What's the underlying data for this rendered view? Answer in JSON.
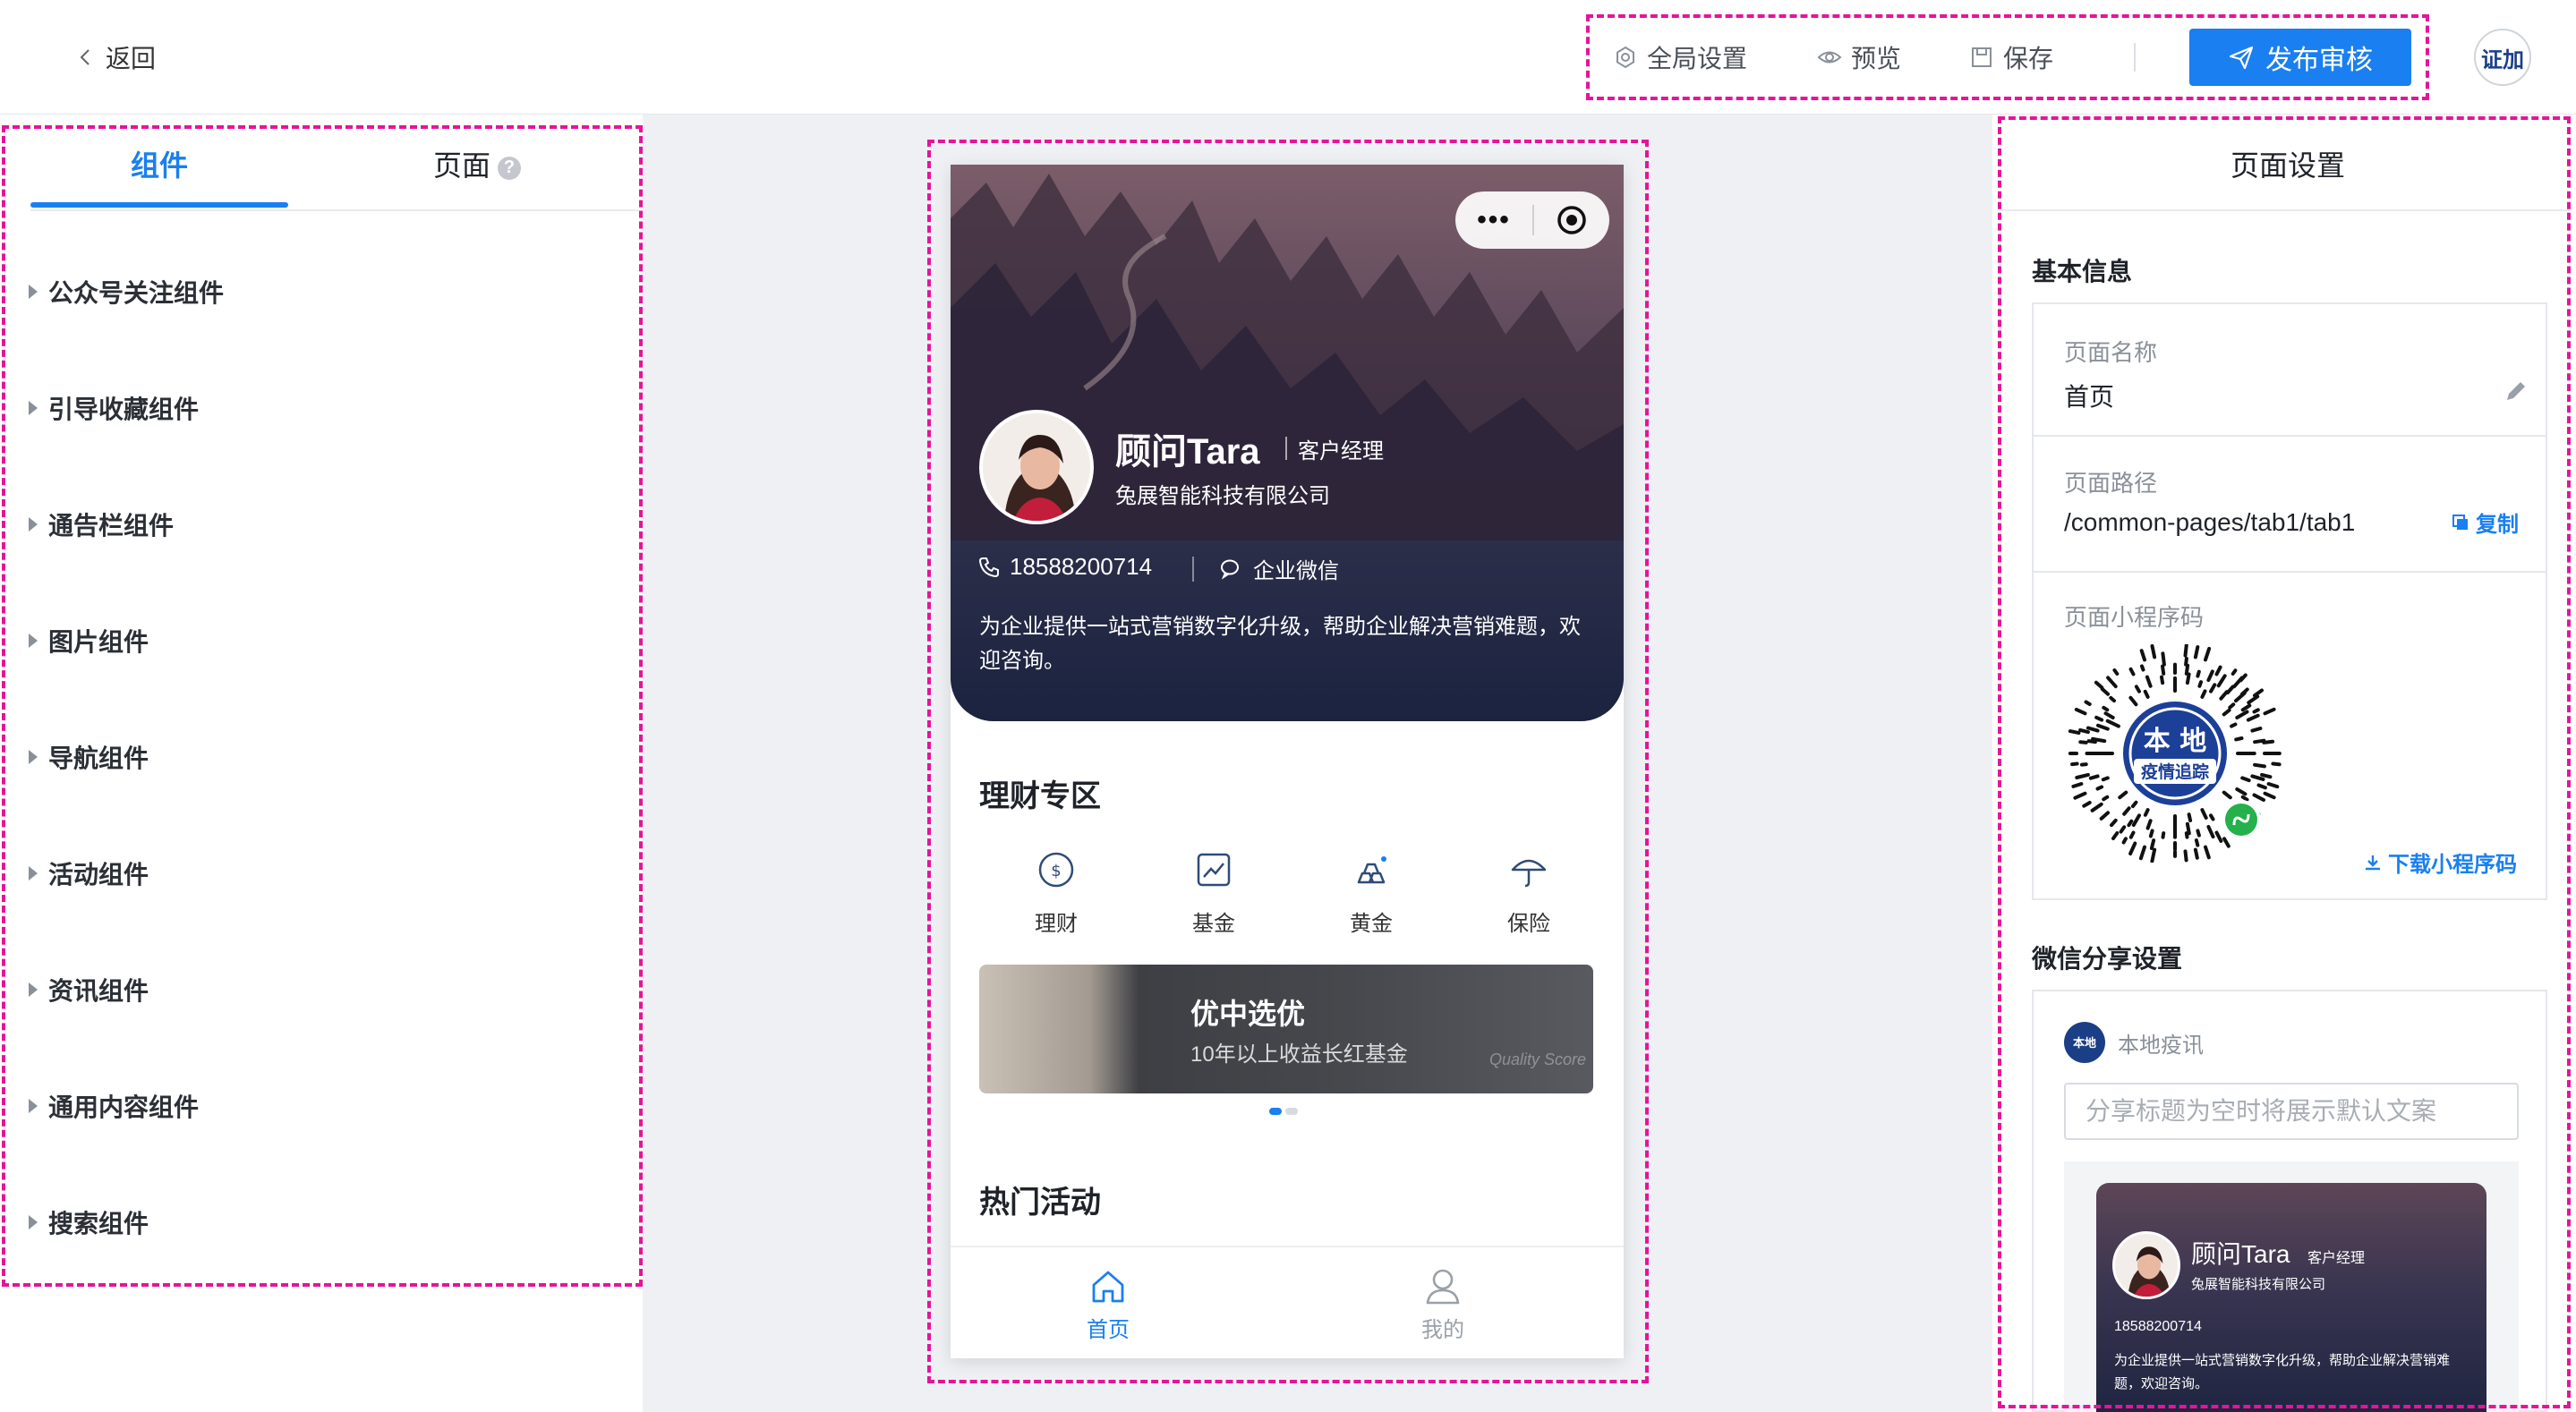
{
  "topbar": {
    "back_label": "返回",
    "global_settings_label": "全局设置",
    "preview_label": "预览",
    "save_label": "保存",
    "publish_label": "发布审核",
    "avatar_text": "证加"
  },
  "left_panel": {
    "tabs": [
      {
        "label": "组件",
        "active": true
      },
      {
        "label": "页面",
        "active": false
      }
    ],
    "help_glyph": "?",
    "components": [
      "公众号关注组件",
      "引导收藏组件",
      "通告栏组件",
      "图片组件",
      "导航组件",
      "活动组件",
      "资讯组件",
      "通用内容组件",
      "搜索组件"
    ]
  },
  "phone": {
    "capsule_dots": "•••",
    "profile": {
      "name": "顾问Tara",
      "role": "客户经理",
      "company": "兔展智能科技有限公司",
      "phone": "18588200714",
      "wecom_label": "企业微信",
      "description": "为企业提供一站式营销数字化升级，帮助企业解决营销难题，欢迎咨询。"
    },
    "finance_section_title": "理财专区",
    "categories": [
      {
        "label": "理财",
        "icon": "dollar-circle-icon"
      },
      {
        "label": "基金",
        "icon": "chart-trend-icon"
      },
      {
        "label": "黄金",
        "icon": "gold-bars-icon"
      },
      {
        "label": "保险",
        "icon": "umbrella-icon"
      }
    ],
    "banner": {
      "title": "优中选优",
      "subtitle": "10年以上收益长红基金",
      "deco_text": "Quality Score"
    },
    "banner_dots": {
      "count": 2,
      "active": 0
    },
    "hot_section_title": "热门活动",
    "tabbar": [
      {
        "label": "首页",
        "icon": "home-icon",
        "active": true
      },
      {
        "label": "我的",
        "icon": "user-icon",
        "active": false
      }
    ]
  },
  "right_panel": {
    "title": "页面设置",
    "basic_info_title": "基本信息",
    "page_name_label": "页面名称",
    "page_name_value": "首页",
    "page_path_label": "页面路径",
    "page_path_value": "/common-pages/tab1/tab1",
    "copy_label": "复制",
    "qrcode_label": "页面小程序码",
    "qrcode_badge_line1": "本 地",
    "qrcode_badge_line2": "疫情追踪",
    "download_label": "下载小程序码",
    "share_title": "微信分享设置",
    "share_brand_name": "本地疫讯",
    "share_logo_text": "本地",
    "share_input_placeholder": "分享标题为空时将展示默认文案",
    "share_input_value": "",
    "share_preview": {
      "name": "顾问Tara",
      "role": "客户经理",
      "company": "兔展智能科技有限公司",
      "phone": "18588200714",
      "description": "为企业提供一站式营销数字化升级，帮助企业解决营销难题，欢迎咨询。"
    }
  },
  "colors": {
    "accent": "#1a7ff0",
    "highlight_border": "#e5149a",
    "page_bg": "#eef0f4"
  }
}
